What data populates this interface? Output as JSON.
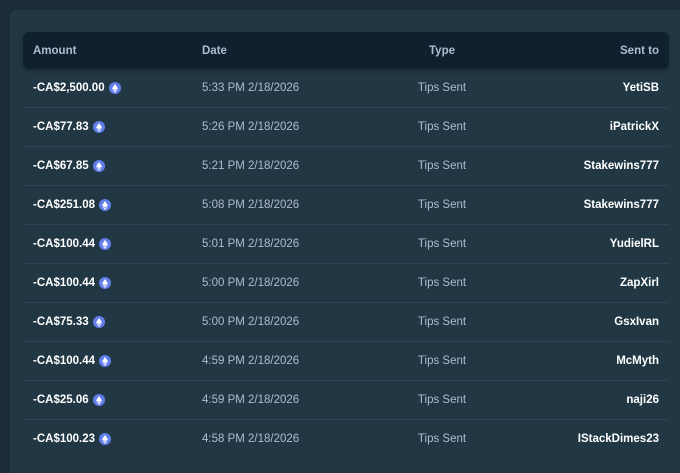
{
  "columns": {
    "amount": "Amount",
    "date": "Date",
    "type": "Type",
    "sent_to": "Sent to"
  },
  "currency_icon": "ethereum-icon",
  "colors": {
    "background": "#1a2c38",
    "panel": "#213743",
    "header": "#0f212e",
    "icon": "#627eea"
  },
  "rows": [
    {
      "amount": "-CA$2,500.00",
      "date": "5:33 PM 2/18/2026",
      "type": "Tips Sent",
      "sent_to": "YetiSB"
    },
    {
      "amount": "-CA$77.83",
      "date": "5:26 PM 2/18/2026",
      "type": "Tips Sent",
      "sent_to": "iPatrickX"
    },
    {
      "amount": "-CA$67.85",
      "date": "5:21 PM 2/18/2026",
      "type": "Tips Sent",
      "sent_to": "Stakewins777"
    },
    {
      "amount": "-CA$251.08",
      "date": "5:08 PM 2/18/2026",
      "type": "Tips Sent",
      "sent_to": "Stakewins777"
    },
    {
      "amount": "-CA$100.44",
      "date": "5:01 PM 2/18/2026",
      "type": "Tips Sent",
      "sent_to": "YudielRL"
    },
    {
      "amount": "-CA$100.44",
      "date": "5:00 PM 2/18/2026",
      "type": "Tips Sent",
      "sent_to": "ZapXirl"
    },
    {
      "amount": "-CA$75.33",
      "date": "5:00 PM 2/18/2026",
      "type": "Tips Sent",
      "sent_to": "GsxIvan"
    },
    {
      "amount": "-CA$100.44",
      "date": "4:59 PM 2/18/2026",
      "type": "Tips Sent",
      "sent_to": "McMyth"
    },
    {
      "amount": "-CA$25.06",
      "date": "4:59 PM 2/18/2026",
      "type": "Tips Sent",
      "sent_to": "naji26"
    },
    {
      "amount": "-CA$100.23",
      "date": "4:58 PM 2/18/2026",
      "type": "Tips Sent",
      "sent_to": "IStackDimes23"
    }
  ]
}
